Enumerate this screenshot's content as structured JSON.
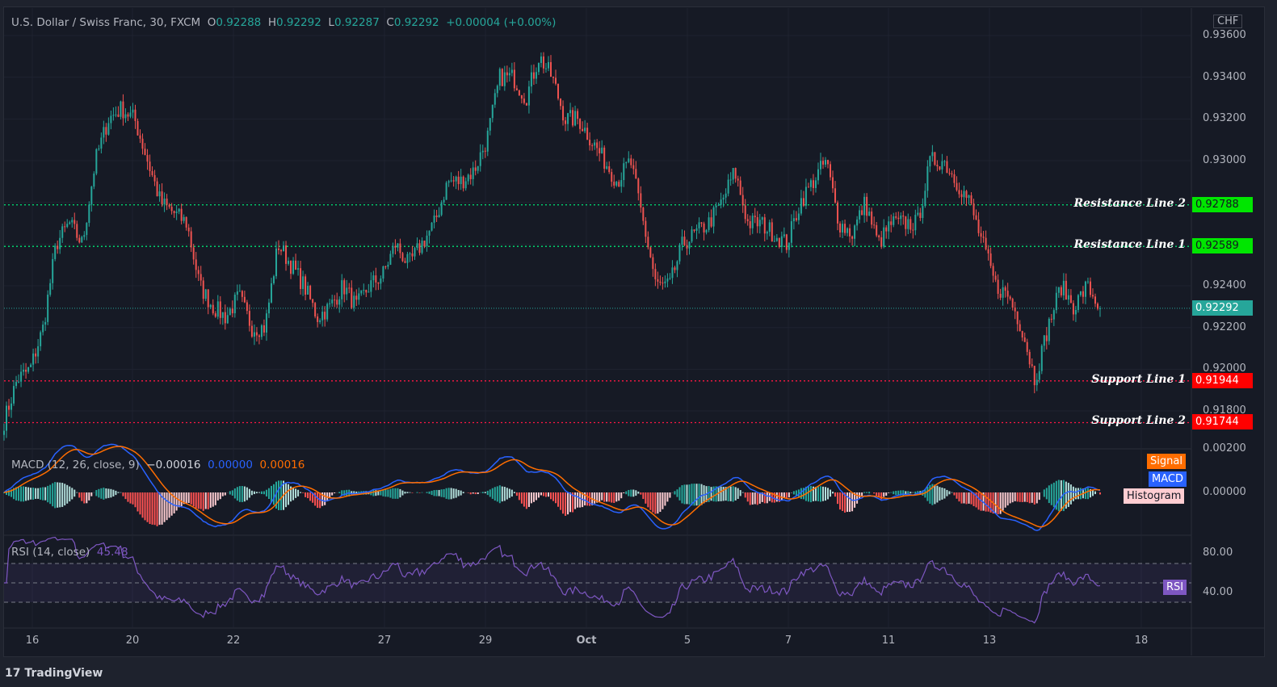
{
  "legend": {
    "symbol": "U.S. Dollar / Swiss Franc, 30, FXCM",
    "o_label": "O",
    "o": "0.92288",
    "h_label": "H",
    "h": "0.92292",
    "l_label": "L",
    "l": "0.92287",
    "c_label": "C",
    "c": "0.92292",
    "change": "+0.00004 (+0.00%)"
  },
  "currency": "CHF",
  "price_axis": [
    "0.93600",
    "0.93400",
    "0.93200",
    "0.93000",
    "0.92200",
    "0.92400",
    "0.92000",
    "0.91800"
  ],
  "lines": [
    {
      "label": "Resistance Line 2",
      "value": "0.92788",
      "color": "#00e676"
    },
    {
      "label": "Resistance Line 1",
      "value": "0.92589",
      "color": "#00e676"
    },
    {
      "label": "Support Line 1",
      "value": "0.91944",
      "color": "#ff1744"
    },
    {
      "label": "Support Line 2",
      "value": "0.91744",
      "color": "#ff1744"
    }
  ],
  "current_price": "0.92292",
  "macd": {
    "label": "MACD (12, 26, close, 9)",
    "v1": "−0.00016",
    "v2": "0.00000",
    "v3": "0.00016",
    "signal_tag": "Signal",
    "macd_tag": "MACD",
    "hist_tag": "Histogram",
    "axis": [
      "0.00200",
      "0.00000"
    ],
    "colors": {
      "macd": "#2962ff",
      "signal": "#ff6d00"
    }
  },
  "rsi": {
    "label": "RSI (14, close)",
    "value": "45.48",
    "tag": "RSI",
    "axis": [
      "80.00",
      "40.00"
    ],
    "color": "#7e57c2"
  },
  "time_axis": [
    "16",
    "20",
    "22",
    "27",
    "29",
    "Oct",
    "5",
    "7",
    "11",
    "13",
    "18"
  ],
  "footer": "TradingView",
  "colors": {
    "up": "#26a69a",
    "down": "#ef5350",
    "background": "#161a25"
  },
  "chart_data": {
    "type": "candlestick",
    "ylim": [
      0.9165,
      0.937
    ],
    "approx_close_path": [
      0.9175,
      0.9195,
      0.92,
      0.922,
      0.926,
      0.927,
      0.926,
      0.93,
      0.932,
      0.9325,
      0.932,
      0.93,
      0.928,
      0.9275,
      0.927,
      0.924,
      0.923,
      0.9225,
      0.9235,
      0.922,
      0.922,
      0.926,
      0.925,
      0.924,
      0.9225,
      0.923,
      0.924,
      0.923,
      0.924,
      0.9245,
      0.926,
      0.925,
      0.926,
      0.927,
      0.929,
      0.929,
      0.9295,
      0.931,
      0.934,
      0.934,
      0.933,
      0.935,
      0.934,
      0.932,
      0.932,
      0.931,
      0.93,
      0.929,
      0.93,
      0.927,
      0.924,
      0.924,
      0.926,
      0.9265,
      0.927,
      0.928,
      0.9295,
      0.927,
      0.927,
      0.9265,
      0.926,
      0.928,
      0.929,
      0.93,
      0.927,
      0.9265,
      0.928,
      0.926,
      0.927,
      0.927,
      0.927,
      0.93,
      0.93,
      0.929,
      0.928,
      0.926,
      0.924,
      0.9235,
      0.922,
      0.9195,
      0.922,
      0.924,
      0.923,
      0.924,
      0.92292
    ]
  }
}
